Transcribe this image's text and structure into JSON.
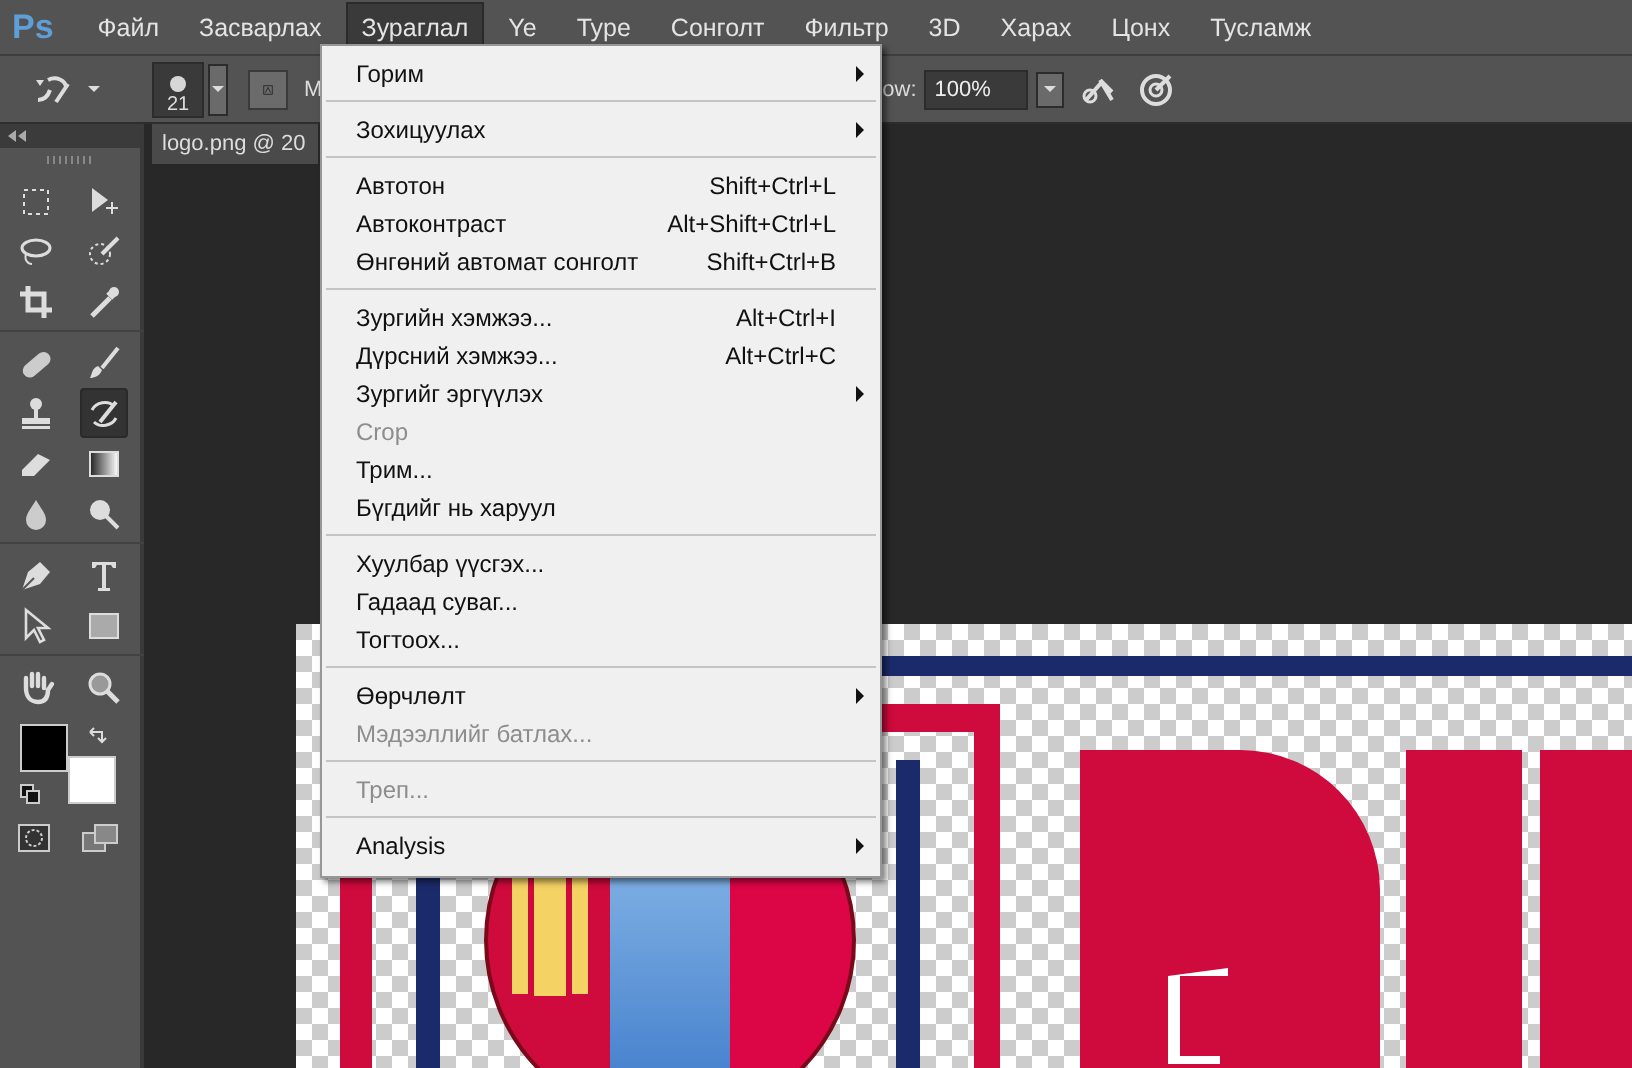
{
  "menubar": {
    "logo": "Ps",
    "items": [
      {
        "label": "Файл",
        "selected": false
      },
      {
        "label": "Засварлах",
        "selected": false
      },
      {
        "label": "Зураглал",
        "selected": true
      },
      {
        "label": "Ye",
        "selected": false
      },
      {
        "label": "Type",
        "selected": false
      },
      {
        "label": "Сонголт",
        "selected": false
      },
      {
        "label": "Фильтр",
        "selected": false
      },
      {
        "label": "3D",
        "selected": false
      },
      {
        "label": "Харах",
        "selected": false
      },
      {
        "label": "Цонх",
        "selected": false
      },
      {
        "label": "Тусламж",
        "selected": false
      }
    ]
  },
  "options_bar": {
    "brush_size": "21",
    "mode_label": "M",
    "flow_label": "ow:",
    "flow_value": "100%"
  },
  "document_tab": {
    "title": "logo.png @ 20"
  },
  "tools": [
    {
      "kind": "marquee",
      "selected": false
    },
    {
      "kind": "move",
      "selected": false
    },
    {
      "kind": "lasso",
      "selected": false
    },
    {
      "kind": "quick-select",
      "selected": false
    },
    {
      "kind": "crop",
      "selected": false
    },
    {
      "kind": "eyedropper",
      "selected": false
    },
    {
      "kind": "separator"
    },
    {
      "kind": "healing",
      "selected": false
    },
    {
      "kind": "brush",
      "selected": false
    },
    {
      "kind": "stamp",
      "selected": false
    },
    {
      "kind": "history-brush",
      "selected": true
    },
    {
      "kind": "eraser",
      "selected": false
    },
    {
      "kind": "gradient",
      "selected": false
    },
    {
      "kind": "blur",
      "selected": false
    },
    {
      "kind": "dodge",
      "selected": false
    },
    {
      "kind": "separator"
    },
    {
      "kind": "pen",
      "selected": false
    },
    {
      "kind": "type",
      "selected": false
    },
    {
      "kind": "path-select",
      "selected": false
    },
    {
      "kind": "rectangle",
      "selected": false
    },
    {
      "kind": "separator"
    },
    {
      "kind": "hand",
      "selected": false
    },
    {
      "kind": "zoom",
      "selected": false
    }
  ],
  "colors": [
    {
      "color": "#000000"
    },
    {
      "color": "#ffffff"
    }
  ],
  "menu": {
    "groups": [
      [
        {
          "label": "Горим",
          "submenu": true,
          "disabled": false
        }
      ],
      [
        {
          "label": "Зохицуулах",
          "submenu": true,
          "disabled": false
        }
      ],
      [
        {
          "label": "Автотон",
          "shortcut": "Shift+Ctrl+L",
          "submenu": false,
          "disabled": false
        },
        {
          "label": "Автоконтраст",
          "shortcut": "Alt+Shift+Ctrl+L",
          "submenu": false,
          "disabled": false
        },
        {
          "label": "Өнгөний автомат сонголт",
          "shortcut": "Shift+Ctrl+B",
          "submenu": false,
          "disabled": false
        }
      ],
      [
        {
          "label": "Зургийн хэмжээ...",
          "shortcut": "Alt+Ctrl+I",
          "submenu": false,
          "disabled": false
        },
        {
          "label": "Дүрсний хэмжээ...",
          "shortcut": "Alt+Ctrl+C",
          "submenu": false,
          "disabled": false
        },
        {
          "label": "Зургийг эргүүлэх",
          "submenu": true,
          "disabled": false
        },
        {
          "label": "Crop",
          "submenu": false,
          "disabled": true
        },
        {
          "label": "Трим...",
          "submenu": false,
          "disabled": false
        },
        {
          "label": "Бүгдийг нь харуул",
          "submenu": false,
          "disabled": false
        }
      ],
      [
        {
          "label": "Хуулбар үүсгэх...",
          "submenu": false,
          "disabled": false
        },
        {
          "label": "Гадаад суваг...",
          "submenu": false,
          "disabled": false
        },
        {
          "label": "Тогтоох...",
          "submenu": false,
          "disabled": false
        }
      ],
      [
        {
          "label": "Өөрчлөлт",
          "submenu": true,
          "disabled": false
        },
        {
          "label": "Мэдээллийг батлах...",
          "submenu": false,
          "disabled": true
        }
      ],
      [
        {
          "label": "Треп...",
          "submenu": false,
          "disabled": true
        }
      ],
      [
        {
          "label": "Analysis",
          "submenu": true,
          "disabled": false
        }
      ]
    ]
  }
}
